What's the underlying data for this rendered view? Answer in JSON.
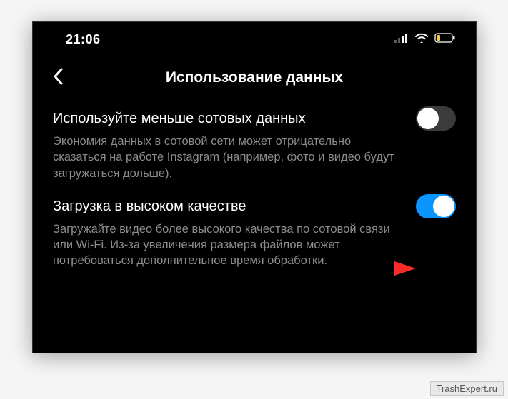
{
  "status": {
    "time": "21:06"
  },
  "header": {
    "title": "Использование данных"
  },
  "settings": [
    {
      "title": "Используйте меньше сотовых данных",
      "desc": "Экономия данных в сотовой сети может отрицательно сказаться на работе Instagram (например, фото и видео будут загружаться дольше).",
      "enabled": false
    },
    {
      "title": "Загрузка в высоком качестве",
      "desc": "Загружайте видео более высокого качества по сотовой связи или Wi-Fi. Из-за увеличения размера файлов может потребоваться дополнительное время обработки.",
      "enabled": true
    }
  ],
  "watermark": "TrashExpert.ru"
}
